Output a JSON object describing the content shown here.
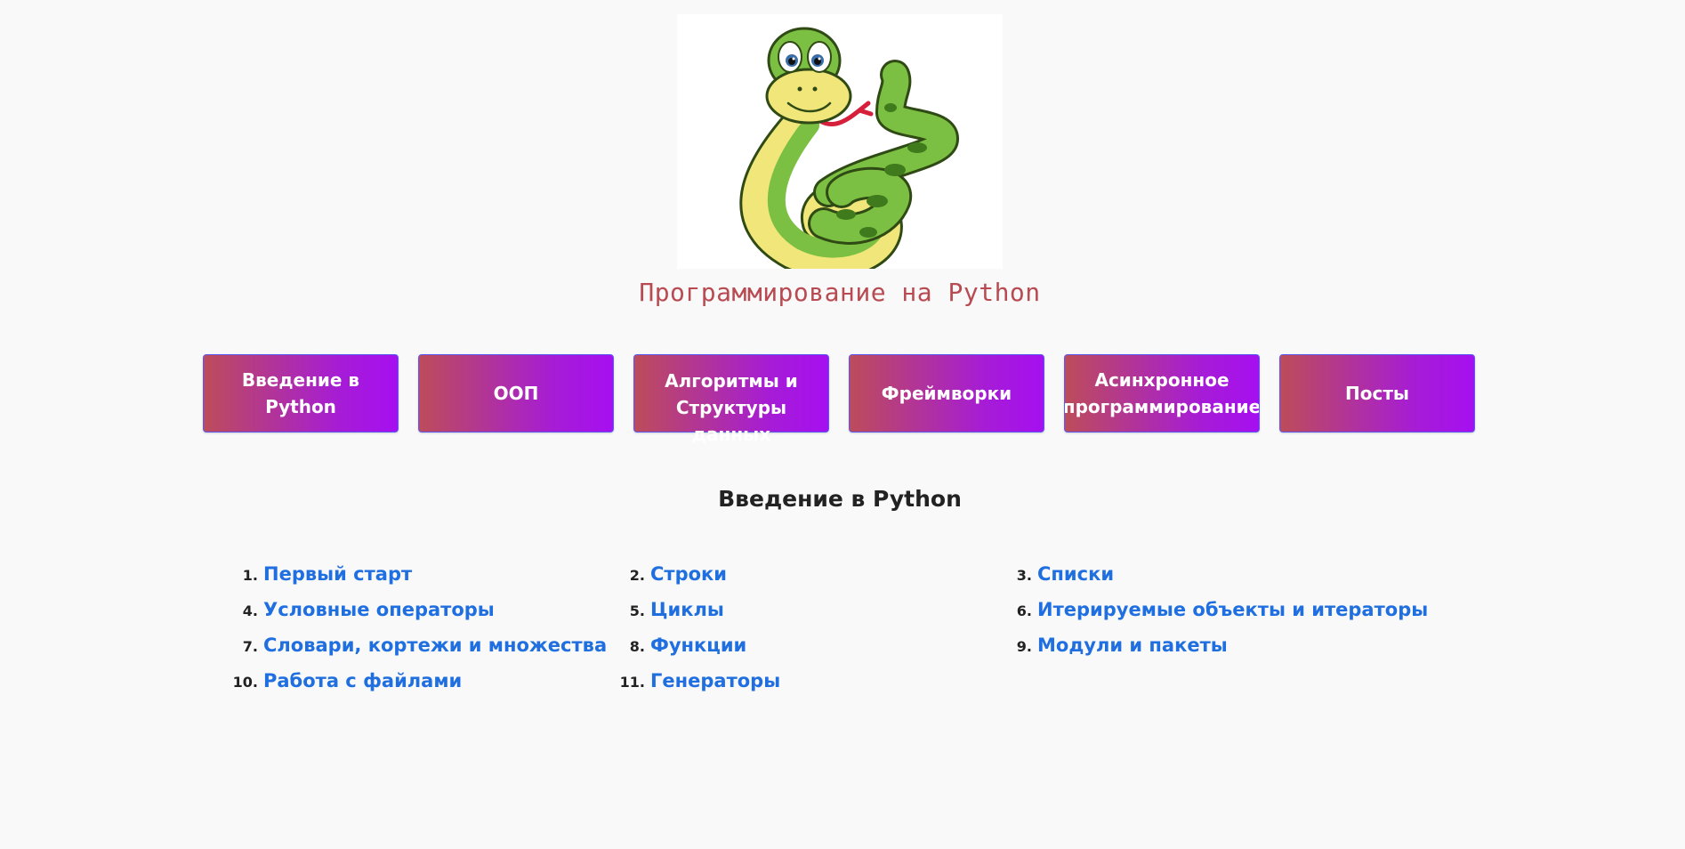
{
  "header": {
    "logo": "python-snake-logo",
    "title": "Программирование на Python"
  },
  "nav": {
    "buttons": [
      {
        "label": "Введение в Python"
      },
      {
        "label": "ООП"
      },
      {
        "label": "Алгоритмы и Структуры данных"
      },
      {
        "label": "Фреймворки"
      },
      {
        "label": "Асинхронное программирование"
      },
      {
        "label": "Посты"
      }
    ]
  },
  "section": {
    "title": "Введение в Python",
    "topics": [
      {
        "num": "1.",
        "label": "Первый старт"
      },
      {
        "num": "2.",
        "label": "Строки"
      },
      {
        "num": "3.",
        "label": "Списки"
      },
      {
        "num": "4.",
        "label": "Условные операторы"
      },
      {
        "num": "5.",
        "label": "Циклы"
      },
      {
        "num": "6.",
        "label": "Итерируемые объекты и итераторы"
      },
      {
        "num": "7.",
        "label": "Словари, кортежи и множества"
      },
      {
        "num": "8.",
        "label": "Функции"
      },
      {
        "num": "9.",
        "label": "Модули и пакеты"
      },
      {
        "num": "10.",
        "label": "Работа с файлами"
      },
      {
        "num": "11.",
        "label": "Генераторы"
      }
    ]
  },
  "colors": {
    "title": "#b84a52",
    "link": "#1f6fe0",
    "button_gradient_start": "#bd4c5a",
    "button_gradient_end": "#a60ff0"
  }
}
